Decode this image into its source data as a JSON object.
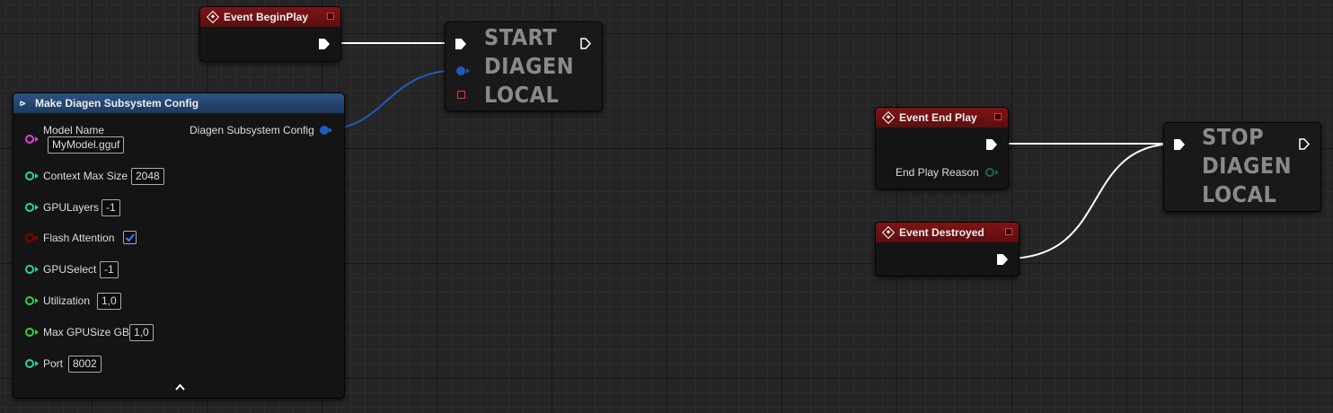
{
  "colors": {
    "event_header": "#7e1416",
    "struct_header": "#2d5283",
    "exec_wire": "#ffffff",
    "struct_wire": "#1f5bbf",
    "string_pin": "#e23ee0",
    "int_pin": "#23d6a4",
    "bool_pin": "#8b0000",
    "float_pin": "#35d13c",
    "enum_pin": "#0a6b5a"
  },
  "nodes": {
    "begin_play": {
      "title": "Event BeginPlay"
    },
    "start_local": {
      "title_lines": [
        "START",
        "DIAGEN",
        "LOCAL"
      ]
    },
    "make_config": {
      "title": "Make Diagen Subsystem Config",
      "output_label": "Diagen Subsystem Config",
      "model_name_label": "Model Name",
      "model_name_value": "MyModel.gguf",
      "context_max_size_label": "Context Max Size",
      "context_max_size_value": "2048",
      "gpu_layers_label": "GPULayers",
      "gpu_layers_value": "-1",
      "flash_attention_label": "Flash Attention",
      "flash_attention_checked": true,
      "gpu_select_label": "GPUSelect",
      "gpu_select_value": "-1",
      "utilization_label": "Utilization",
      "utilization_value": "1,0",
      "max_gpu_size_label": "Max GPUSize GB",
      "max_gpu_size_value": "1,0",
      "port_label": "Port",
      "port_value": "8002",
      "collapse_icon": "chevron-up-icon"
    },
    "end_play": {
      "title": "Event End Play",
      "reason_label": "End Play Reason"
    },
    "destroyed": {
      "title": "Event Destroyed"
    },
    "stop_local": {
      "title_lines": [
        "STOP",
        "DIAGEN",
        "LOCAL"
      ]
    }
  }
}
